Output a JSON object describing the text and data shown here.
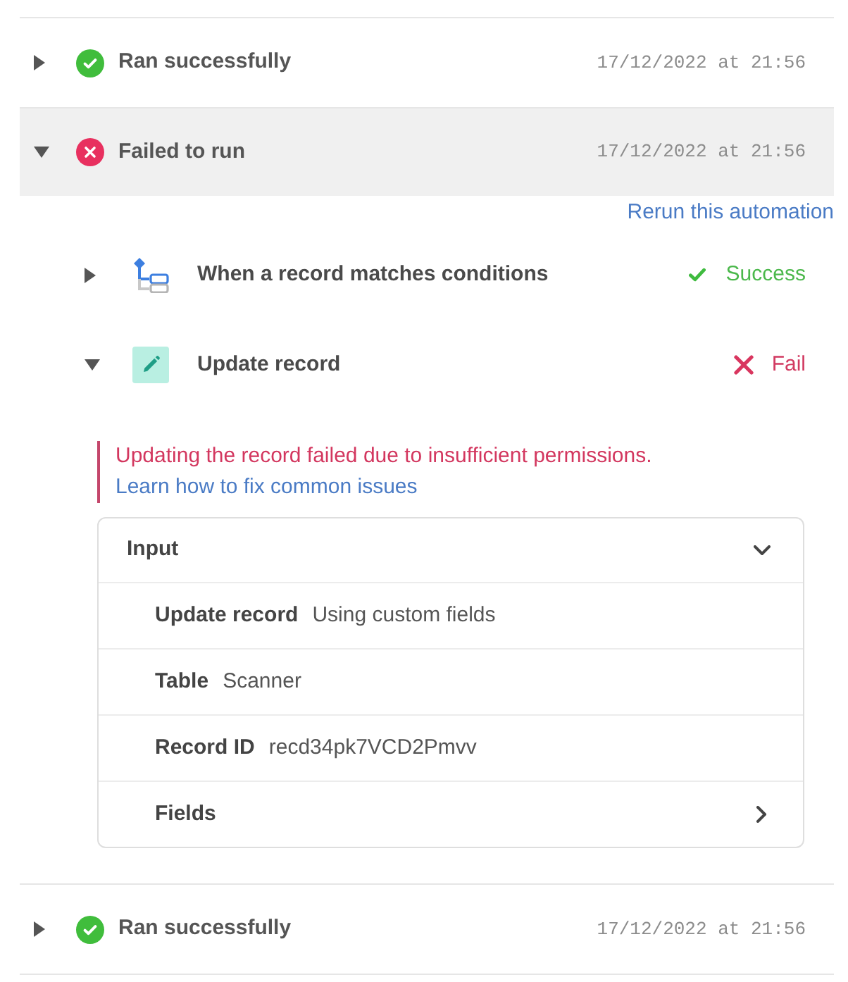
{
  "runs": [
    {
      "kind": "success",
      "label": "Ran successfully",
      "time": "17/12/2022 at 21:56",
      "expanded": false,
      "selected": false
    },
    {
      "kind": "failed",
      "label": "Failed to run",
      "time": "17/12/2022 at 21:56",
      "expanded": true,
      "selected": true,
      "rerun_link": "Rerun this automation",
      "steps": [
        {
          "kind": "trigger",
          "title": "When a record matches conditions",
          "expanded": false,
          "result": {
            "kind": "success",
            "label": "Success"
          }
        },
        {
          "kind": "action",
          "title": "Update record",
          "expanded": true,
          "result": {
            "kind": "fail",
            "label": "Fail"
          },
          "error": {
            "message": "Updating the record failed due to insufficient permissions.",
            "help_link": "Learn how to fix common issues"
          },
          "input": {
            "title": "Input",
            "expanded": true,
            "rows": [
              {
                "label": "Update record",
                "value": "Using custom fields"
              },
              {
                "label": "Table",
                "value": "Scanner"
              },
              {
                "label": "Record ID",
                "value": "recd34pk7VCD2Pmvv"
              },
              {
                "label": "Fields",
                "expanded": false
              }
            ]
          }
        }
      ]
    },
    {
      "kind": "success",
      "label": "Ran successfully",
      "time": "17/12/2022 at 21:56",
      "expanded": false,
      "selected": false
    }
  ]
}
